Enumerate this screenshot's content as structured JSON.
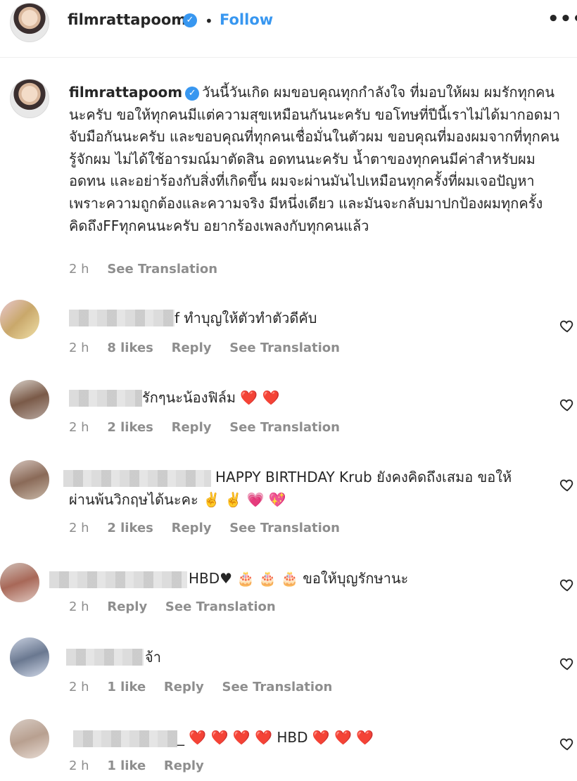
{
  "post": {
    "username": "filmrattapoom",
    "separator": "•",
    "follow_label": "Follow",
    "more_label": "•••"
  },
  "caption": {
    "username": "filmrattapoom",
    "text": "วันนี้วันเกิด ผมขอบคุณทุกกำลังใจ ที่มอบให้ผม ผมรักทุกคนนะครับ ขอให้ทุกคนมีแต่ความสุขเหมือนกันนะครับ ขอโทษที่ปีนี้เราไม่ได้มากอดมาจับมือกันนะครับ และขอบคุณที่ทุกคนเชื่อมั่นในตัวผม ขอบคุณที่มองผมจากที่ทุกคนรู้จักผม ไม่ได้ใช้อารมณ์มาตัดสิน อดทนนะครับ น้ำตาของทุกคนมีค่าสำหรับผม อดทน และอย่าร้องกับสิ่งที่เกิดขึ้น ผมจะผ่านมันไปเหมือนทุกครั้งที่ผมเจอปัญหา เพราะความถูกต้องและความจริง มีหนึ่งเดียว และมันจะกลับมาปกป้องผมทุกครั้ง คิดถึงFFทุกคนนะครับ อยากร้องเพลงกับทุกคนแล้ว",
    "time": "2 h",
    "translate": "See Translation"
  },
  "comments": [
    {
      "text": "f ทำบุญให้ตัวทำตัวดีคับ",
      "time": "2 h",
      "likes": "8 likes",
      "reply": "Reply",
      "translate": "See Translation"
    },
    {
      "text": "รักๆนะน้องฟิล์ม ❤️ ❤️",
      "time": "2 h",
      "likes": "2 likes",
      "reply": "Reply",
      "translate": "See Translation"
    },
    {
      "text": "HAPPY BIRTHDAY Krub ยังคงคิดถึงเสมอ ขอให้ผ่านพ้นวิกฤษได้นะคะ ✌️ ✌️ 💗 💖",
      "time": "2 h",
      "likes": "2 likes",
      "reply": "Reply",
      "translate": "See Translation"
    },
    {
      "text": "HBD♥ 🎂 🎂 🎂 ขอให้บุญรักษานะ",
      "time": "2 h",
      "likes": "",
      "reply": "Reply",
      "translate": "See Translation"
    },
    {
      "text": "จ้า",
      "time": "2 h",
      "likes": "1 like",
      "reply": "Reply",
      "translate": "See Translation"
    },
    {
      "text": "_ ❤️ ❤️ ❤️ ❤️ HBD ❤️ ❤️ ❤️",
      "time": "2 h",
      "likes": "1 like",
      "reply": "Reply",
      "translate": ""
    }
  ],
  "icons": {
    "heart": "heart-outline-icon",
    "verified": "verified-badge-icon"
  },
  "colors": {
    "link": "#3897f0",
    "meta": "#8e8e8e",
    "text": "#262626"
  }
}
